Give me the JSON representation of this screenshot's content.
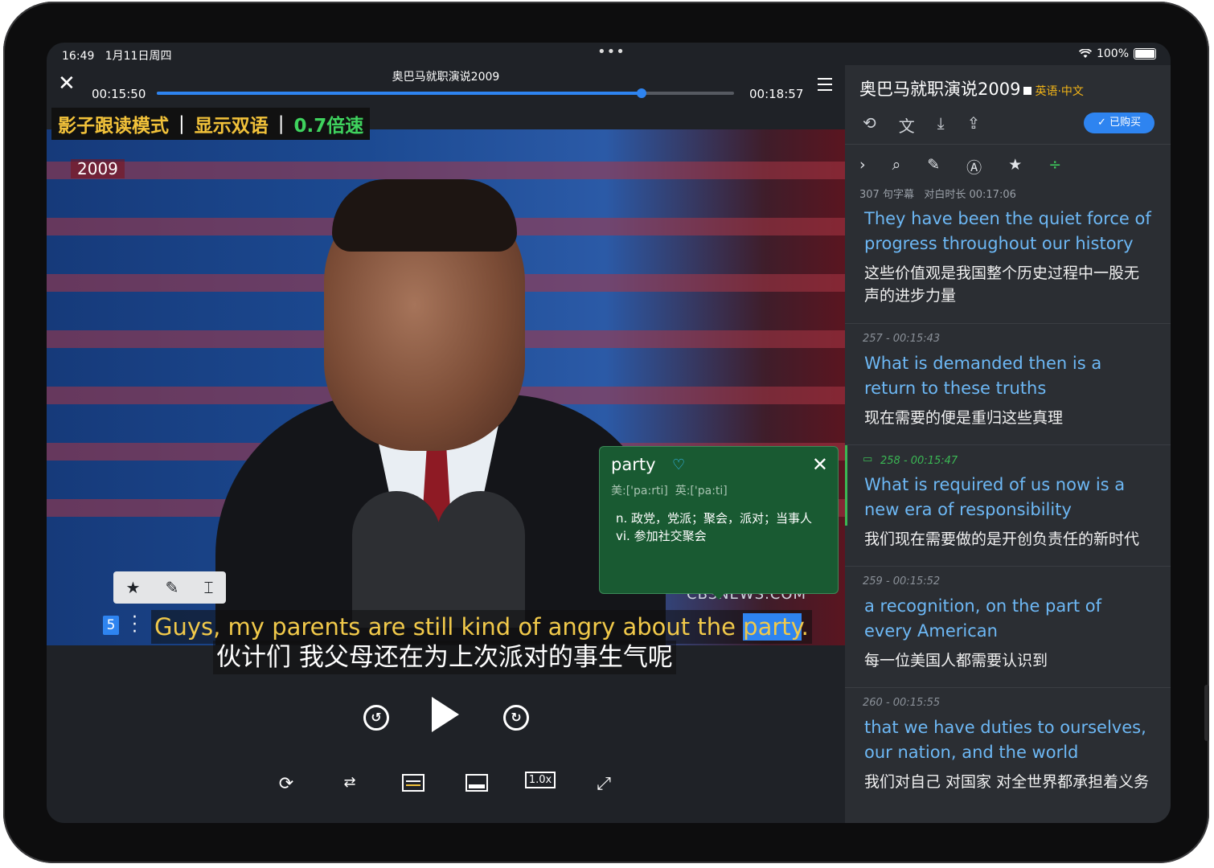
{
  "status": {
    "time": "16:49",
    "date": "1月11日周四",
    "dots": "•••",
    "wifi": "WiFi",
    "battery": "100%"
  },
  "player": {
    "title": "奥巴马就职演说2009",
    "current_time": "00:15:50",
    "total_time": "00:18:57",
    "progress": 0.84,
    "modes": {
      "shadow": "影子跟读模式",
      "bilingual": "显示双语",
      "speed": "0.7倍速"
    },
    "video": {
      "year_badge": "2009",
      "watermark": "CBSNEWS.COM"
    },
    "subtitle": {
      "index": "5",
      "en_before": "Guys, my parents are still kind of ",
      "en_angry": "angry",
      "en_mid": " about the ",
      "en_hl": "party",
      "en_after": ".",
      "zh": "伙计们 我父母还在为上次派对的事生气呢"
    },
    "popup": {
      "word": "party",
      "phonetic_us": "美:['pa:rti]",
      "phonetic_uk": "英:['pa:ti]",
      "def1": "n. 政党，党派；聚会，派对；当事人",
      "def2": "vi. 参加社交聚会"
    },
    "bottom_controls": {
      "speed": "1.0x"
    }
  },
  "panel": {
    "title": "奥巴马就职演说2009",
    "lang": "英语·中文",
    "bought": "已购买",
    "meta_count": "307 句字幕",
    "meta_duration": "对白时长 00:17:06",
    "cards": [
      {
        "meta": "",
        "en": "They have been the quiet force of progress throughout our history",
        "zh": "这些价值观是我国整个历史过程中一股无声的进步力量"
      },
      {
        "meta": "257  -  00:15:43",
        "en": "What is demanded then is a return to these truths",
        "zh": "现在需要的便是重归这些真理"
      },
      {
        "meta": "258  -  00:15:47",
        "en": "What is required of us now is a new era of responsibility",
        "zh": "我们现在需要做的是开创负责任的新时代"
      },
      {
        "meta": "259  -  00:15:52",
        "en": "a recognition, on the part of every American",
        "zh": "每一位美国人都需要认识到"
      },
      {
        "meta": "260  -  00:15:55",
        "en": "that we have duties to ourselves, our nation, and the world",
        "zh": "我们对自己  对国家  对全世界都承担着义务"
      }
    ]
  },
  "colors": {
    "accent": "#2e84f0",
    "mode_shadow": "#f2c23a",
    "mode_bilingual": "#f2c23a",
    "mode_speed": "#3fd35e",
    "panel_en": "#6db8f5",
    "popup_bg": "#195a32"
  }
}
